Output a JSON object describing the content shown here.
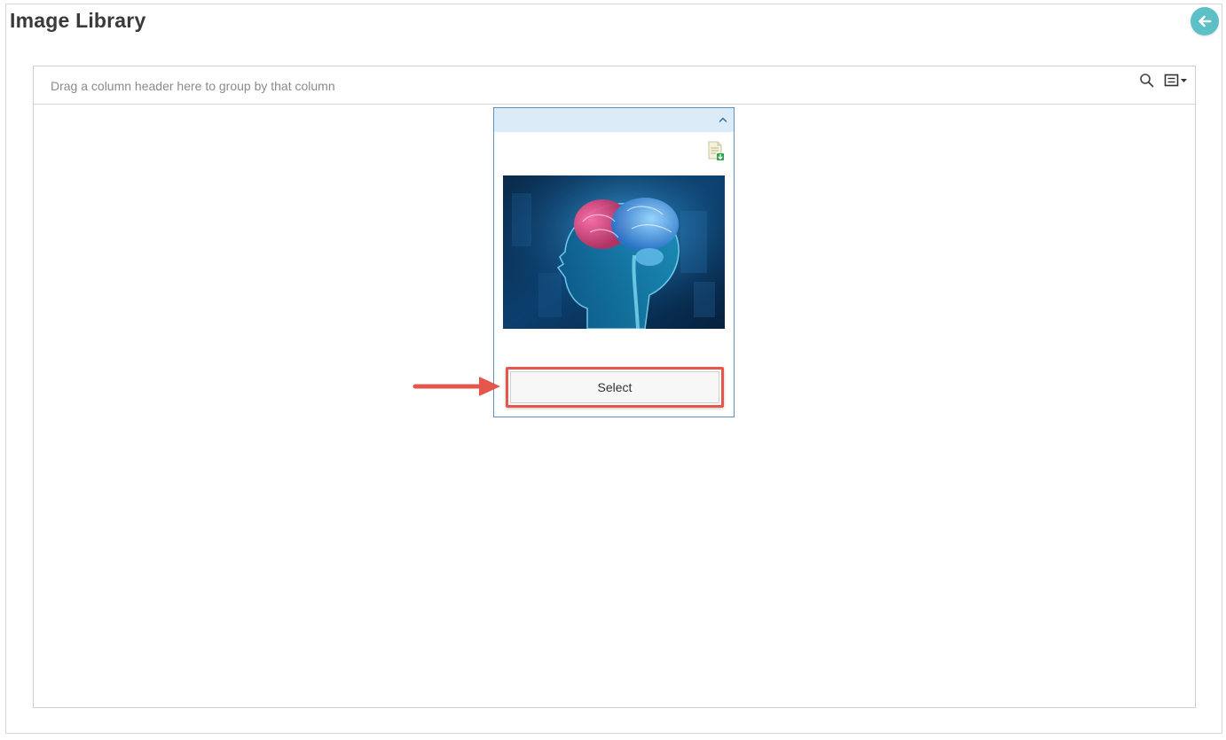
{
  "page": {
    "title": "Image Library"
  },
  "grid": {
    "group_hint": "Drag a column header here to group by that column"
  },
  "card": {
    "select_label": "Select"
  },
  "icons": {
    "back": "arrow-left-circle-icon",
    "search": "search-icon",
    "column_chooser": "column-menu-icon",
    "collapse": "chevron-up-icon",
    "download": "file-download-icon"
  },
  "colors": {
    "accent_teal": "#5cc0c6",
    "card_border": "#5b93c6",
    "card_header": "#dcebf8",
    "highlight_red": "#e5574c"
  }
}
